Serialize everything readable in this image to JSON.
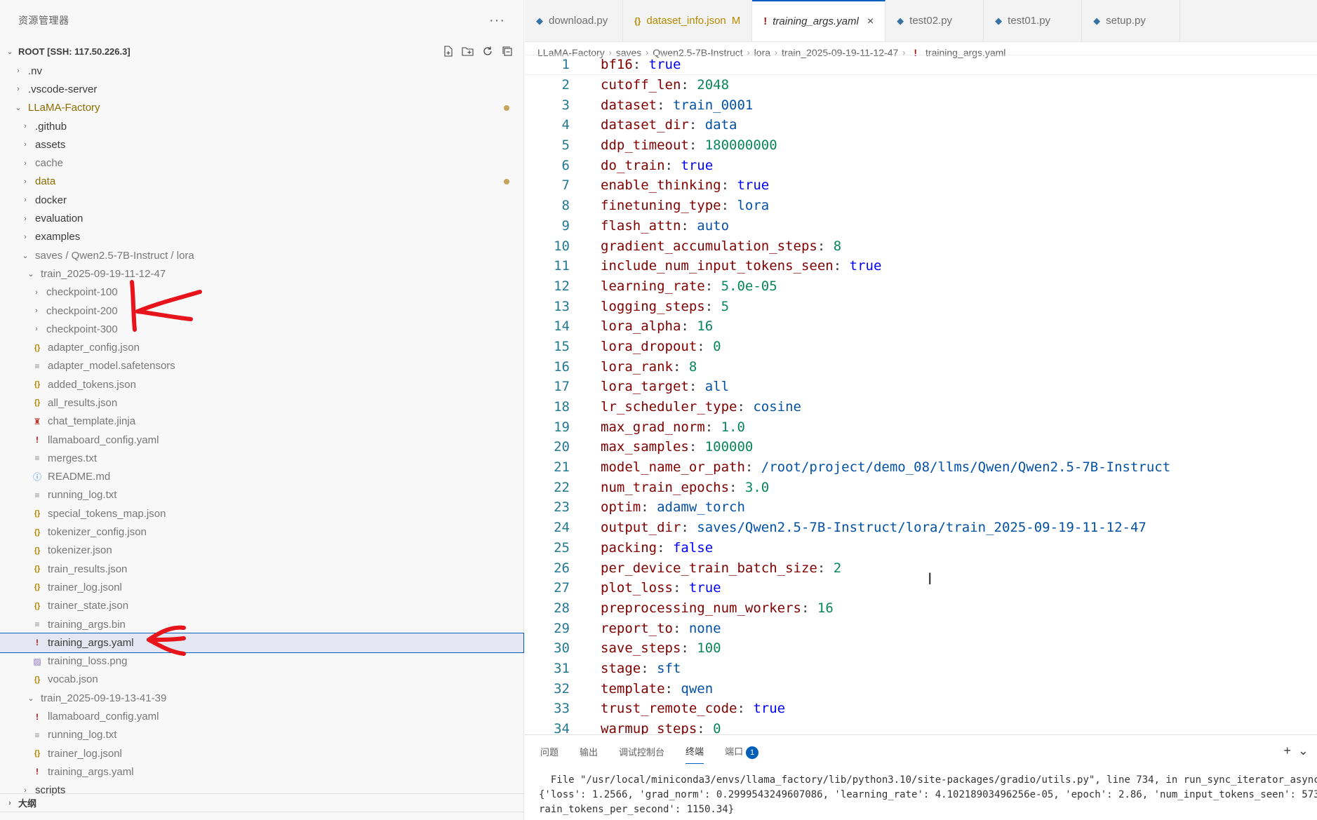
{
  "sidebar": {
    "title": "资源管理器",
    "more": "···",
    "root_label": "ROOT [SSH: 117.50.226.3]",
    "tree": [
      {
        "label": ".nv",
        "kind": "folder",
        "depth": 1,
        "open": false
      },
      {
        "label": ".vscode-server",
        "kind": "folder",
        "depth": 1,
        "open": false
      },
      {
        "label": "LLaMA-Factory",
        "kind": "folder",
        "depth": 1,
        "open": true,
        "modified": true
      },
      {
        "label": ".github",
        "kind": "folder",
        "depth": 2,
        "open": false
      },
      {
        "label": "assets",
        "kind": "folder",
        "depth": 2,
        "open": false
      },
      {
        "label": "cache",
        "kind": "folder",
        "depth": 2,
        "open": false,
        "dim": true
      },
      {
        "label": "data",
        "kind": "folder",
        "depth": 2,
        "open": false,
        "modified": true
      },
      {
        "label": "docker",
        "kind": "folder",
        "depth": 2,
        "open": false
      },
      {
        "label": "evaluation",
        "kind": "folder",
        "depth": 2,
        "open": false
      },
      {
        "label": "examples",
        "kind": "folder",
        "depth": 2,
        "open": false
      },
      {
        "label": "saves / Qwen2.5-7B-Instruct / lora",
        "kind": "folder",
        "depth": 2,
        "open": true,
        "dim": true
      },
      {
        "label": "train_2025-09-19-11-12-47",
        "kind": "folder",
        "depth": 3,
        "open": true,
        "dim": true
      },
      {
        "label": "checkpoint-100",
        "kind": "folder",
        "depth": 4,
        "open": false,
        "dim": true
      },
      {
        "label": "checkpoint-200",
        "kind": "folder",
        "depth": 4,
        "open": false,
        "dim": true
      },
      {
        "label": "checkpoint-300",
        "kind": "folder",
        "depth": 4,
        "open": false,
        "dim": true
      },
      {
        "label": "adapter_config.json",
        "kind": "file",
        "icon": "json",
        "depth": 4,
        "dim": true
      },
      {
        "label": "adapter_model.safetensors",
        "kind": "file",
        "icon": "txt",
        "depth": 4,
        "dim": true
      },
      {
        "label": "added_tokens.json",
        "kind": "file",
        "icon": "json",
        "depth": 4,
        "dim": true
      },
      {
        "label": "all_results.json",
        "kind": "file",
        "icon": "json",
        "depth": 4,
        "dim": true
      },
      {
        "label": "chat_template.jinja",
        "kind": "file",
        "icon": "jinja",
        "depth": 4,
        "dim": true
      },
      {
        "label": "llamaboard_config.yaml",
        "kind": "file",
        "icon": "yaml",
        "depth": 4,
        "dim": true
      },
      {
        "label": "merges.txt",
        "kind": "file",
        "icon": "txt",
        "depth": 4,
        "dim": true
      },
      {
        "label": "README.md",
        "kind": "file",
        "icon": "info",
        "depth": 4,
        "dim": true
      },
      {
        "label": "running_log.txt",
        "kind": "file",
        "icon": "txt",
        "depth": 4,
        "dim": true
      },
      {
        "label": "special_tokens_map.json",
        "kind": "file",
        "icon": "json",
        "depth": 4,
        "dim": true
      },
      {
        "label": "tokenizer_config.json",
        "kind": "file",
        "icon": "json",
        "depth": 4,
        "dim": true
      },
      {
        "label": "tokenizer.json",
        "kind": "file",
        "icon": "json",
        "depth": 4,
        "dim": true
      },
      {
        "label": "train_results.json",
        "kind": "file",
        "icon": "json",
        "depth": 4,
        "dim": true
      },
      {
        "label": "trainer_log.jsonl",
        "kind": "file",
        "icon": "json",
        "depth": 4,
        "dim": true
      },
      {
        "label": "trainer_state.json",
        "kind": "file",
        "icon": "json",
        "depth": 4,
        "dim": true
      },
      {
        "label": "training_args.bin",
        "kind": "file",
        "icon": "txt",
        "depth": 4,
        "dim": true
      },
      {
        "label": "training_args.yaml",
        "kind": "file",
        "icon": "yaml",
        "depth": 4,
        "selected": true
      },
      {
        "label": "training_loss.png",
        "kind": "file",
        "icon": "img",
        "depth": 4,
        "dim": true
      },
      {
        "label": "vocab.json",
        "kind": "file",
        "icon": "json",
        "depth": 4,
        "dim": true
      },
      {
        "label": "train_2025-09-19-13-41-39",
        "kind": "folder",
        "depth": 3,
        "open": true,
        "dim": true
      },
      {
        "label": "llamaboard_config.yaml",
        "kind": "file",
        "icon": "yaml",
        "depth": 4,
        "dim": true
      },
      {
        "label": "running_log.txt",
        "kind": "file",
        "icon": "txt",
        "depth": 4,
        "dim": true
      },
      {
        "label": "trainer_log.jsonl",
        "kind": "file",
        "icon": "json",
        "depth": 4,
        "dim": true
      },
      {
        "label": "training_args.yaml",
        "kind": "file",
        "icon": "yaml",
        "depth": 4,
        "dim": true
      },
      {
        "label": "scripts",
        "kind": "folder",
        "depth": 2,
        "open": false
      }
    ],
    "outline_label": "大纲"
  },
  "tabs": [
    {
      "label": "download.py",
      "icon": "py"
    },
    {
      "label": "dataset_info.json",
      "icon": "json",
      "badge": "M"
    },
    {
      "label": "training_args.yaml",
      "icon": "yaml",
      "active": true,
      "close": "×"
    },
    {
      "label": "test02.py",
      "icon": "py"
    },
    {
      "label": "test01.py",
      "icon": "py"
    },
    {
      "label": "setup.py",
      "icon": "py"
    }
  ],
  "breadcrumb": [
    "LLaMA-Factory",
    "saves",
    "Qwen2.5-7B-Instruct",
    "lora",
    "train_2025-09-19-11-12-47",
    "training_args.yaml"
  ],
  "code": [
    {
      "n": "1",
      "k": "bf16",
      "v": "true",
      "t": "bool"
    },
    {
      "n": "2",
      "k": "cutoff_len",
      "v": "2048",
      "t": "num"
    },
    {
      "n": "3",
      "k": "dataset",
      "v": "train_0001",
      "t": "str"
    },
    {
      "n": "4",
      "k": "dataset_dir",
      "v": "data",
      "t": "str"
    },
    {
      "n": "5",
      "k": "ddp_timeout",
      "v": "180000000",
      "t": "num"
    },
    {
      "n": "6",
      "k": "do_train",
      "v": "true",
      "t": "bool"
    },
    {
      "n": "7",
      "k": "enable_thinking",
      "v": "true",
      "t": "bool"
    },
    {
      "n": "8",
      "k": "finetuning_type",
      "v": "lora",
      "t": "str"
    },
    {
      "n": "9",
      "k": "flash_attn",
      "v": "auto",
      "t": "str"
    },
    {
      "n": "10",
      "k": "gradient_accumulation_steps",
      "v": "8",
      "t": "num"
    },
    {
      "n": "11",
      "k": "include_num_input_tokens_seen",
      "v": "true",
      "t": "bool"
    },
    {
      "n": "12",
      "k": "learning_rate",
      "v": "5.0e-05",
      "t": "num"
    },
    {
      "n": "13",
      "k": "logging_steps",
      "v": "5",
      "t": "num"
    },
    {
      "n": "14",
      "k": "lora_alpha",
      "v": "16",
      "t": "num"
    },
    {
      "n": "15",
      "k": "lora_dropout",
      "v": "0",
      "t": "num"
    },
    {
      "n": "16",
      "k": "lora_rank",
      "v": "8",
      "t": "num"
    },
    {
      "n": "17",
      "k": "lora_target",
      "v": "all",
      "t": "str"
    },
    {
      "n": "18",
      "k": "lr_scheduler_type",
      "v": "cosine",
      "t": "str"
    },
    {
      "n": "19",
      "k": "max_grad_norm",
      "v": "1.0",
      "t": "num"
    },
    {
      "n": "20",
      "k": "max_samples",
      "v": "100000",
      "t": "num"
    },
    {
      "n": "21",
      "k": "model_name_or_path",
      "v": "/root/project/demo_08/llms/Qwen/Qwen2.5-7B-Instruct",
      "t": "str"
    },
    {
      "n": "22",
      "k": "num_train_epochs",
      "v": "3.0",
      "t": "num"
    },
    {
      "n": "23",
      "k": "optim",
      "v": "adamw_torch",
      "t": "str"
    },
    {
      "n": "24",
      "k": "output_dir",
      "v": "saves/Qwen2.5-7B-Instruct/lora/train_2025-09-19-11-12-47",
      "t": "str"
    },
    {
      "n": "25",
      "k": "packing",
      "v": "false",
      "t": "bool"
    },
    {
      "n": "26",
      "k": "per_device_train_batch_size",
      "v": "2",
      "t": "num"
    },
    {
      "n": "27",
      "k": "plot_loss",
      "v": "true",
      "t": "bool"
    },
    {
      "n": "28",
      "k": "preprocessing_num_workers",
      "v": "16",
      "t": "num"
    },
    {
      "n": "29",
      "k": "report_to",
      "v": "none",
      "t": "str"
    },
    {
      "n": "30",
      "k": "save_steps",
      "v": "100",
      "t": "num"
    },
    {
      "n": "31",
      "k": "stage",
      "v": "sft",
      "t": "str"
    },
    {
      "n": "32",
      "k": "template",
      "v": "qwen",
      "t": "str"
    },
    {
      "n": "33",
      "k": "trust_remote_code",
      "v": "true",
      "t": "bool"
    },
    {
      "n": "34",
      "k": "warmup_steps",
      "v": "0",
      "t": "num"
    }
  ],
  "panel": {
    "tabs": [
      "问题",
      "输出",
      "调试控制台",
      "终端",
      "端口"
    ],
    "active_tab": "终端",
    "ports_badge": "1",
    "add": "+",
    "terminal_lines": [
      "  File \"/usr/local/miniconda3/envs/llama_factory/lib/python3.10/site-packages/gradio/utils.py\", line 734, in run_sync_iterator_async",
      "{'loss': 1.2566, 'grad_norm': 0.2999543249607086, 'learning_rate': 4.10218903496256e-05, 'epoch': 2.86, 'num_input_tokens_seen': 573",
      "rain_tokens_per_second': 1150.34}"
    ]
  },
  "colors": {
    "accent": "#0060c0",
    "annotation": "#e8141c",
    "key": "#800000",
    "bool": "#0000ff",
    "num": "#098658",
    "str": "#0451a5"
  }
}
